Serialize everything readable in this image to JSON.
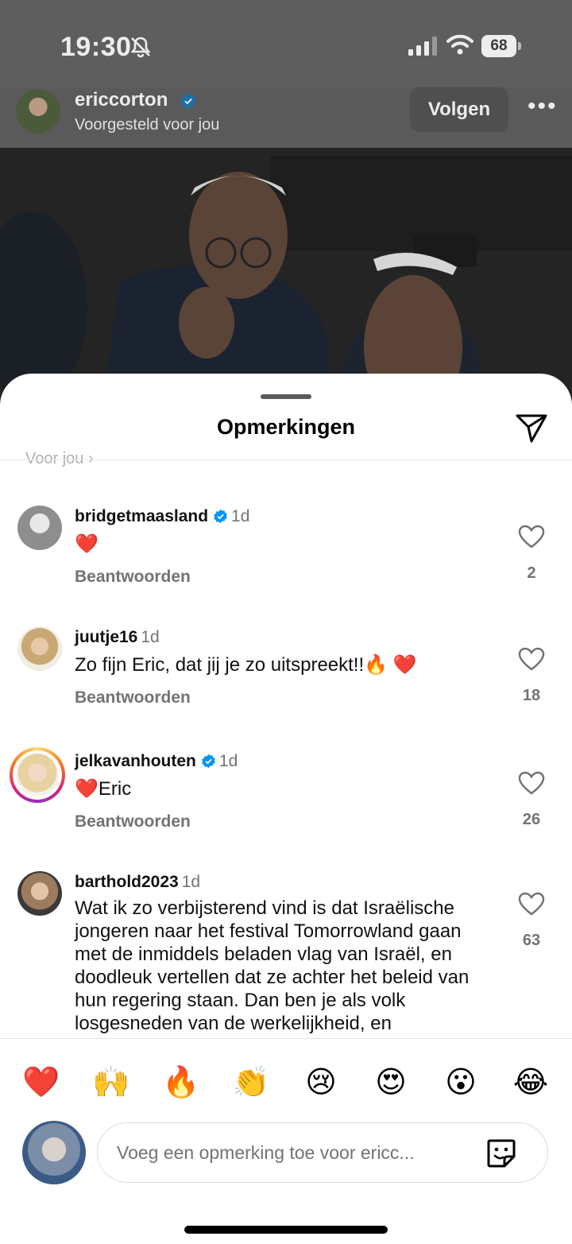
{
  "status_bar": {
    "time": "19:30",
    "battery": "68"
  },
  "post": {
    "username": "ericcorton",
    "subtitle": "Voorgesteld voor jou",
    "follow_label": "Volgen",
    "more_label": "•••"
  },
  "sheet": {
    "title": "Opmerkingen",
    "ghost_text": "Voor jou ›"
  },
  "comments": [
    {
      "user": "bridgetmaasland",
      "verified": true,
      "time": "1d",
      "text": "❤️",
      "reply": "Beantwoorden",
      "likes": "2"
    },
    {
      "user": "juutje16",
      "verified": false,
      "time": "1d",
      "text": "Zo fijn Eric, dat jij je zo uitspreekt!!🔥 ❤️",
      "reply": "Beantwoorden",
      "likes": "18"
    },
    {
      "user": "jelkavanhouten",
      "verified": true,
      "time": "1d",
      "text": "❤️Eric",
      "reply": "Beantwoorden",
      "likes": "26"
    },
    {
      "user": "barthold2023",
      "verified": false,
      "time": "1d",
      "text": "Wat ik zo verbijsterend vind is dat Israëlische jongeren naar het festival Tomorrowland gaan met de inmiddels beladen vlag van Israël, en doodleuk vertellen dat ze achter het beleid van hun regering staan. Dan ben je als volk losgesneden van de werkelijkheid, en",
      "reply": "",
      "likes": "63"
    }
  ],
  "emojis": [
    "❤️",
    "🙌",
    "🔥",
    "👏",
    "😢",
    "😍",
    "😮",
    "😂"
  ],
  "input": {
    "placeholder": "Voeg een opmerking toe voor ericc..."
  },
  "colors": {
    "verified": "#0095f6",
    "like": "#737373",
    "story_ring": "#d62976"
  }
}
